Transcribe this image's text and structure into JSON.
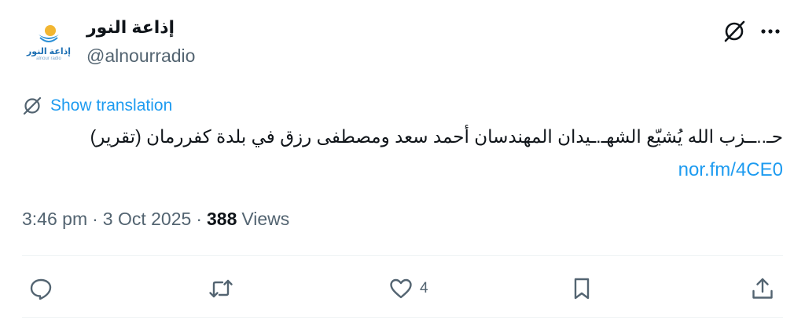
{
  "account": {
    "display_name": "إذاعة النور",
    "handle": "@alnourradio",
    "avatar_logo_text": "إذاعة النور",
    "avatar_logo_sub": "alnour radio"
  },
  "header_icons": {
    "grok": "grok-icon",
    "more": "more-icon"
  },
  "translation": {
    "label": "Show translation",
    "icon": "translate-icon"
  },
  "tweet": {
    "text": "حـ..ــزب الله يُشيّع الشهـ.ـيدان المهندسان أحمد سعد ومصطفى رزق في بلدة كفررمان (تقرير)",
    "link": "nor.fm/4CE0"
  },
  "meta": {
    "time": "3:46 pm",
    "separator": "·",
    "date": "3 Oct 2025",
    "views_count": "388",
    "views_label": "Views"
  },
  "actions": {
    "reply": {
      "icon": "reply-icon",
      "count": ""
    },
    "retweet": {
      "icon": "retweet-icon",
      "count": ""
    },
    "like": {
      "icon": "heart-icon",
      "count": "4"
    },
    "bookmark": {
      "icon": "bookmark-icon",
      "count": ""
    },
    "share": {
      "icon": "share-icon",
      "count": ""
    }
  },
  "colors": {
    "accent": "#1d9bf0",
    "text_primary": "#0f1419",
    "text_secondary": "#536471",
    "divider": "#eff3f4"
  }
}
